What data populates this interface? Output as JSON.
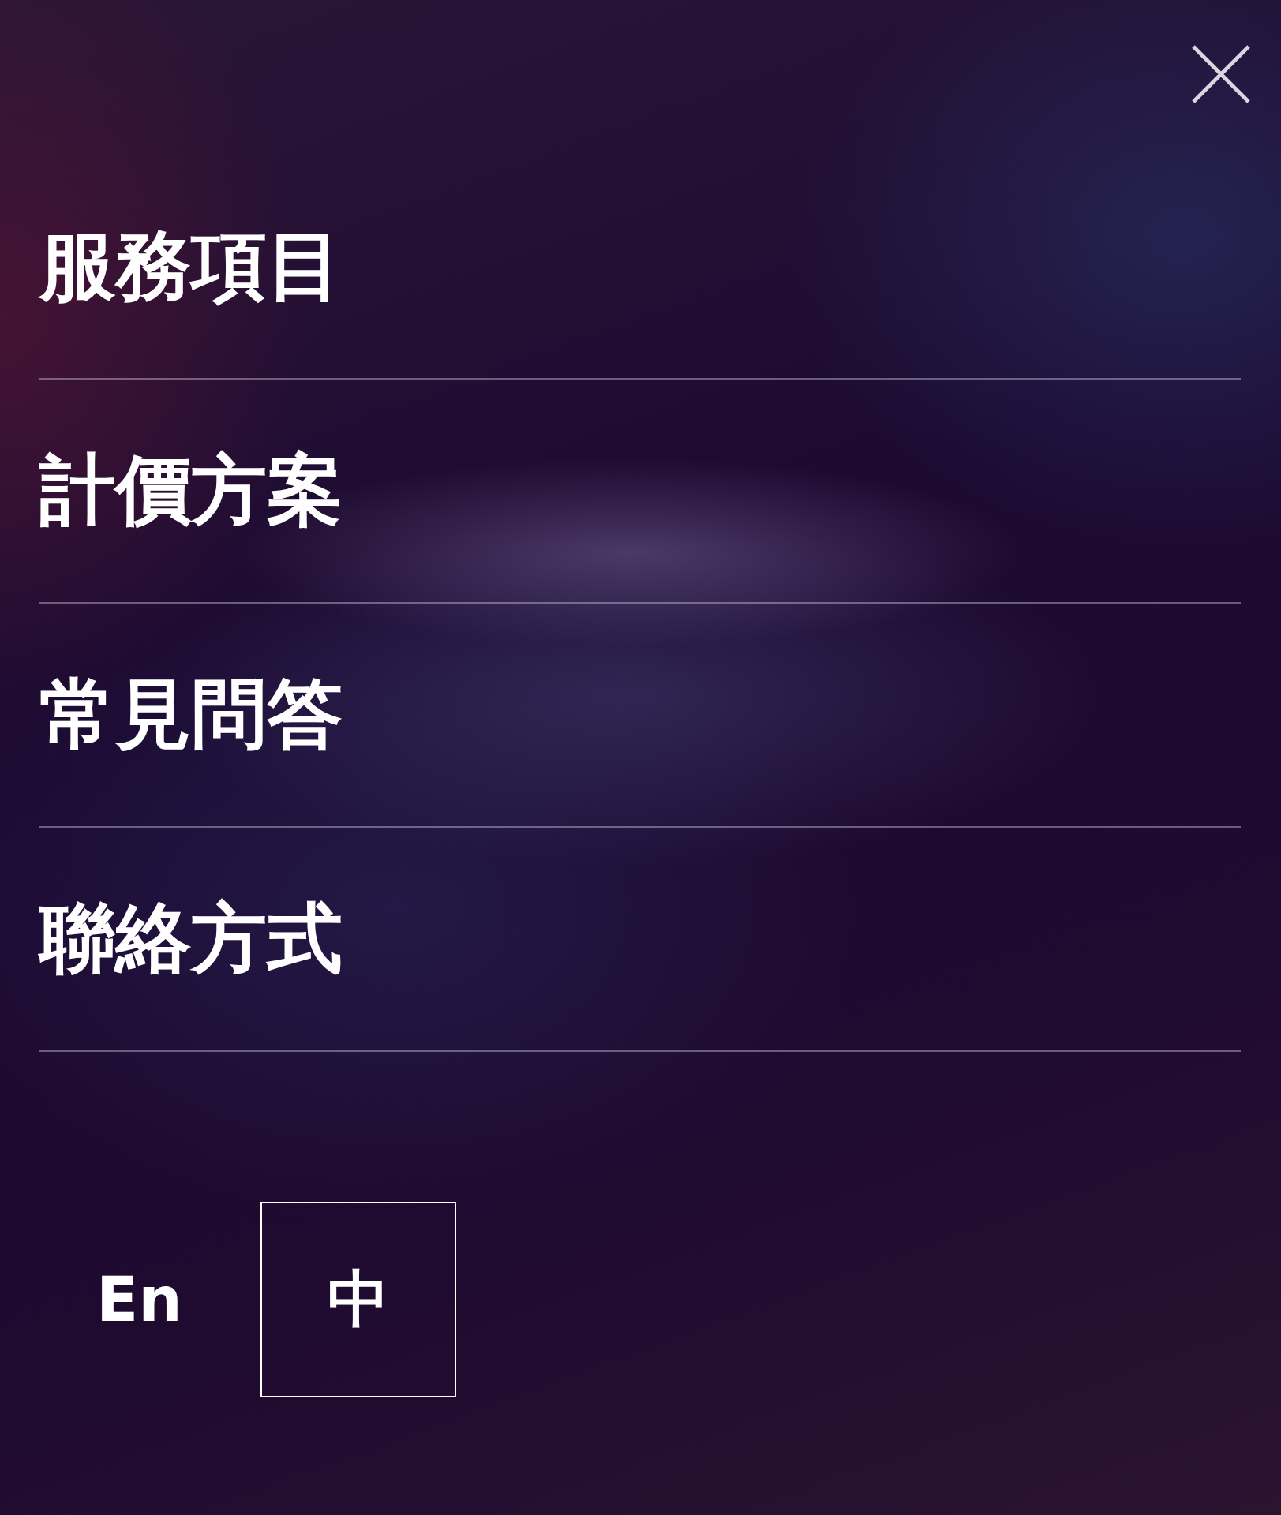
{
  "menu_items": [
    {
      "label": "服務項目"
    },
    {
      "label": "計價方案"
    },
    {
      "label": "常見問答"
    },
    {
      "label": "聯絡方式"
    }
  ],
  "languages": [
    {
      "label": "En",
      "selected": false
    },
    {
      "label": "中",
      "selected": true
    }
  ]
}
